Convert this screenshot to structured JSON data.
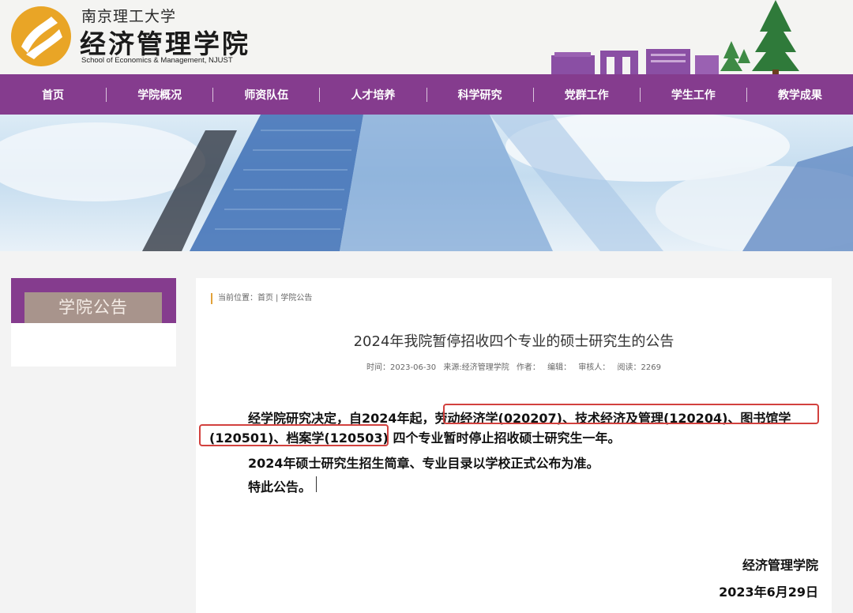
{
  "header": {
    "school_cn": "南京理工大学",
    "college_cn": "经济管理学院",
    "college_en": "School of Economics & Management, NJUST",
    "logo_icon": "njust-logo-icon",
    "brand_color": "#853c8e"
  },
  "nav": {
    "items": [
      "首页",
      "学院概况",
      "师资队伍",
      "人才培养",
      "科学研究",
      "党群工作",
      "学生工作",
      "教学成果"
    ]
  },
  "sidebar": {
    "title": "学院公告"
  },
  "breadcrumb": {
    "prefix": "当前位置：",
    "home": "首页",
    "separator": "|",
    "current": "学院公告"
  },
  "article": {
    "title": "2024年我院暂停招收四个专业的硕士研究生的公告",
    "meta": {
      "time": "时间：2023-06-30",
      "source": "来源:经济管理学院",
      "author": "作者：",
      "editor": "编辑：",
      "reviewer": "审核人：",
      "views": "阅读：2269"
    },
    "line1_prefix": "经学院研究决定，自2024年起，",
    "line1_highlight": "劳动经济学(020207)、技术经济及管理(120204)、图书馆学",
    "line2_highlight": "(120501)、档案学(120503)",
    "line2_suffix": "四个专业暂时停止招收硕士研究生一年。",
    "line3": "2024年硕士研究生招生简章、专业目录以学校正式公布为准。",
    "line4": "特此公告。",
    "signature": "经济管理学院",
    "date": "2023年6月29日",
    "highlight_color": "#d2413e"
  }
}
